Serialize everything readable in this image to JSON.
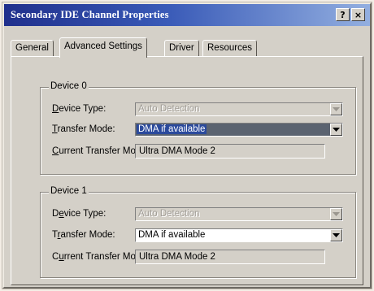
{
  "window": {
    "title": "Secondary IDE Channel Properties",
    "help_glyph": "?",
    "close_glyph": "×"
  },
  "tabs": [
    {
      "label": "General",
      "active": false
    },
    {
      "label": "Advanced Settings",
      "active": true
    },
    {
      "label": "Driver",
      "active": false
    },
    {
      "label": "Resources",
      "active": false
    }
  ],
  "devices": [
    {
      "legend": "Device 0",
      "device_type": {
        "label_u": "D",
        "label_rest": "evice Type:",
        "value": "Auto Detection",
        "enabled": false
      },
      "transfer_mode": {
        "label_u": "T",
        "label_rest": "ransfer Mode:",
        "value": "DMA if available",
        "enabled": true,
        "selected": true
      },
      "current_mode": {
        "label_u": "C",
        "label_rest": "urrent Transfer Mode:",
        "value": "Ultra DMA Mode 2"
      }
    },
    {
      "legend": "Device 1",
      "device_type": {
        "label_pre": "D",
        "label_u": "e",
        "label_rest": "vice Type:",
        "value": "Auto Detection",
        "enabled": false
      },
      "transfer_mode": {
        "label_pre": "T",
        "label_u": "r",
        "label_rest": "ansfer Mode:",
        "value": "DMA if available",
        "enabled": true,
        "selected": false
      },
      "current_mode": {
        "label_pre": "C",
        "label_u": "u",
        "label_rest": "rrent Transfer Mode:",
        "value": "Ultra DMA Mode 2"
      }
    }
  ],
  "colors": {
    "title_gradient_start": "#1f2f8c",
    "title_gradient_end": "#93afe0",
    "face": "#d4d0c8",
    "selection": "#2b4a9c"
  }
}
